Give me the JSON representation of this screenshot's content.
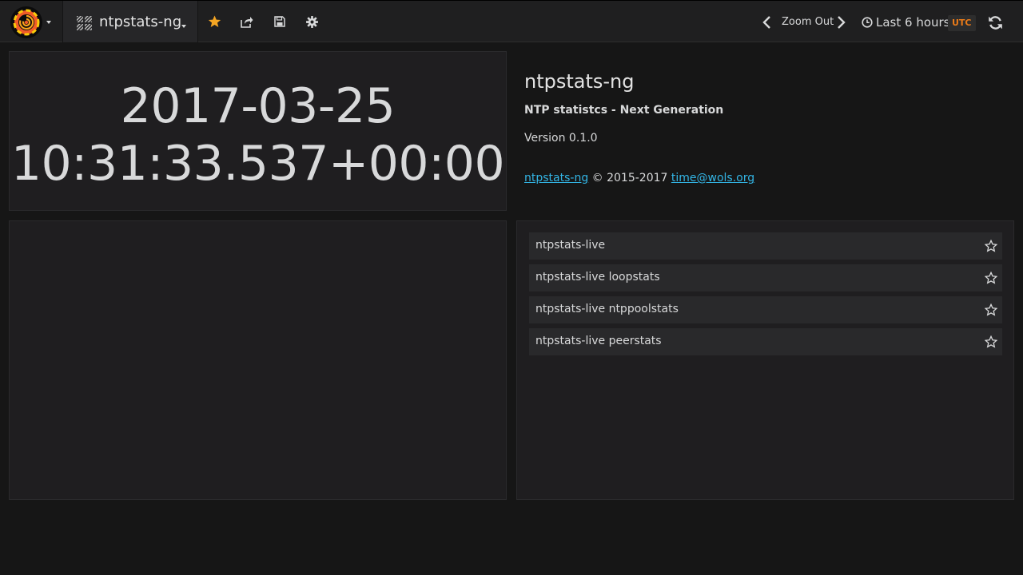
{
  "navbar": {
    "dashboard_title": "ntpstats-ng",
    "zoom_out_label": "Zoom Out",
    "time_range_label": "Last 6 hours",
    "timezone_badge": "UTC",
    "icons": {
      "logo": "grafana-logo-icon",
      "dashboard": "dashboard-grid-icon",
      "star": "star-icon",
      "share": "share-icon",
      "save": "save-icon",
      "settings": "gear-icon",
      "prev": "chevron-left-icon",
      "next": "chevron-right-icon",
      "clock": "clock-icon",
      "refresh": "refresh-icon"
    },
    "accent_color": "#f5a623",
    "badge_color": "#eb7b18"
  },
  "clock_panel": {
    "date": "2017-03-25",
    "time": "10:31:33.537+00:00"
  },
  "about_panel": {
    "title": "ntpstats-ng",
    "subtitle": "NTP statistcs - Next Generation",
    "version": "Version 0.1.0",
    "footer_link_text": "ntpstats-ng",
    "footer_copyright": "© 2015-2017",
    "footer_email": "time@wols.org",
    "link_color": "#33b5e5"
  },
  "dashboard_list": {
    "items": [
      {
        "label": "ntpstats-live"
      },
      {
        "label": "ntpstats-live loopstats"
      },
      {
        "label": "ntpstats-live ntppoolstats"
      },
      {
        "label": "ntpstats-live peerstats"
      }
    ]
  }
}
